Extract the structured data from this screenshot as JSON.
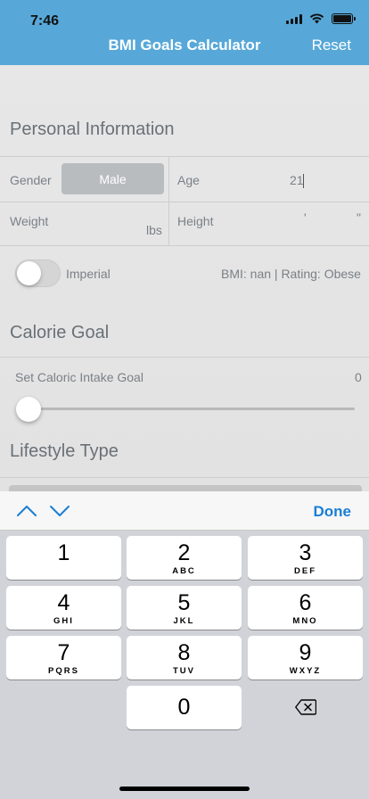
{
  "status_bar": {
    "time": "7:46"
  },
  "nav": {
    "title": "BMI Goals Calculator",
    "reset_label": "Reset"
  },
  "personal": {
    "title": "Personal Information",
    "gender_label": "Gender",
    "gender_value": "Male",
    "age_label": "Age",
    "age_value": "21",
    "weight_label": "Weight",
    "weight_unit": "lbs",
    "height_label": "Height",
    "height_feet_mark": "'",
    "height_inch_mark": "\"",
    "units_toggle_label": "Imperial",
    "bmi_summary": "BMI: nan | Rating: Obese"
  },
  "calorie": {
    "title": "Calorie Goal",
    "slider_label": "Set Caloric Intake Goal",
    "slider_value": "0",
    "slider_fraction": 0
  },
  "lifestyle": {
    "title": "Lifestyle Type"
  },
  "accessory": {
    "done_label": "Done"
  },
  "keypad": {
    "keys": [
      {
        "num": "1",
        "letters": ""
      },
      {
        "num": "2",
        "letters": "ABC"
      },
      {
        "num": "3",
        "letters": "DEF"
      },
      {
        "num": "4",
        "letters": "GHI"
      },
      {
        "num": "5",
        "letters": "JKL"
      },
      {
        "num": "6",
        "letters": "MNO"
      },
      {
        "num": "7",
        "letters": "PQRS"
      },
      {
        "num": "8",
        "letters": "TUV"
      },
      {
        "num": "9",
        "letters": "WXYZ"
      },
      {
        "num": "0",
        "letters": ""
      }
    ]
  },
  "colors": {
    "header": "#57a8d8",
    "accent": "#1a7fd4",
    "keypad_bg": "#d1d3d8"
  }
}
